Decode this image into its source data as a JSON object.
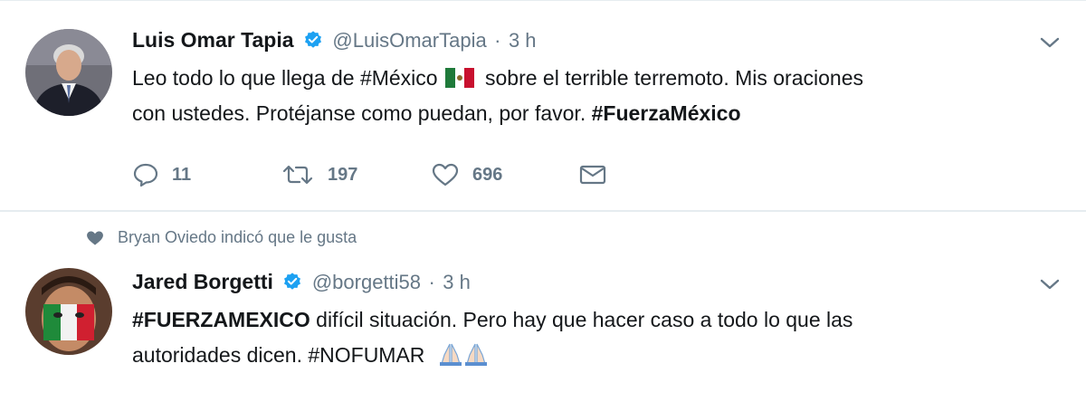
{
  "tweets": [
    {
      "author": "Luis Omar Tapia",
      "handle": "@LuisOmarTapia",
      "separator": "·",
      "time": "3 h",
      "text_part1": "Leo todo lo que llega de ",
      "hashtag1": "#México",
      "text_part2": " sobre el terrible terremoto. Mis oraciones",
      "text_line2": "con ustedes. Protéjanse como puedan, por favor. ",
      "hashtag2": "#FuerzaMéxico",
      "replies": "11",
      "retweets": "197",
      "likes": "696",
      "icons": [
        "reply-icon",
        "retweet-icon",
        "like-icon",
        "direct-message-icon"
      ]
    },
    {
      "social_context": "Bryan Oviedo indicó que le gusta",
      "author": "Jared Borgetti",
      "handle": "@borgetti58",
      "separator": "·",
      "time": "3 h",
      "hashtag1": "#FUERZAMEXICO",
      "text_part1": " difícil situación. Pero hay que hacer caso a todo lo que las",
      "text_line2": "autoridades dicen. ",
      "hashtag2": "#NOFUMAR"
    }
  ],
  "colors": {
    "verified": "#1da1f2",
    "muted": "#657786",
    "text": "#14171a",
    "divider": "#e6ecf0"
  }
}
